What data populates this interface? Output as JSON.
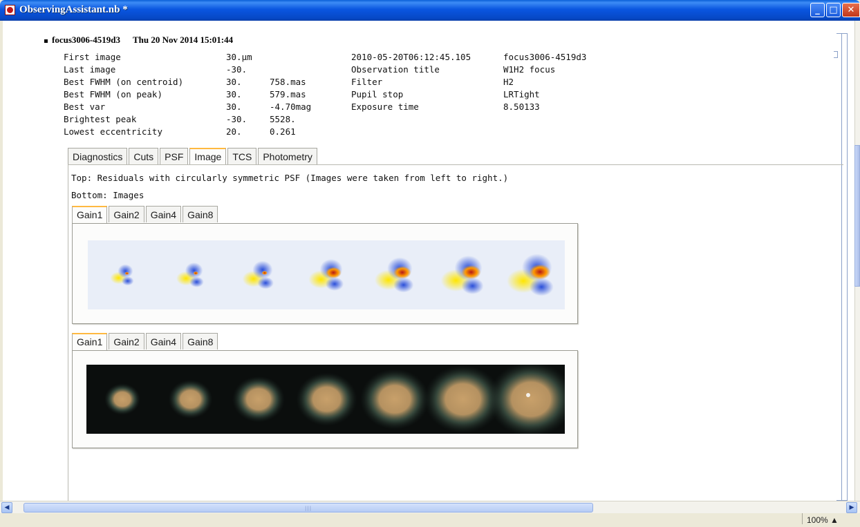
{
  "window": {
    "title": "ObservingAssistant.nb *",
    "buttons": {
      "minimize": "‗",
      "maximize": "□",
      "close": "✕"
    }
  },
  "cell": {
    "name": "focus3006-4519d3",
    "timestamp": "Thu 20 Nov 2014 15:01:44"
  },
  "summary": {
    "rows": [
      {
        "label": "First image",
        "value": "30.µm",
        "extra": ""
      },
      {
        "label": "Last image",
        "value": "-30.",
        "extra": ""
      },
      {
        "label": "Best FWHM (on centroid)",
        "value": "30.",
        "extra": "758.mas"
      },
      {
        "label": "Best FWHM (on peak)",
        "value": "30.",
        "extra": "579.mas"
      },
      {
        "label": "Best var",
        "value": "30.",
        "extra": "-4.70mag"
      },
      {
        "label": "Brightest peak",
        "value": "-30.",
        "extra": "5528."
      },
      {
        "label": "Lowest eccentricity",
        "value": "20.",
        "extra": "0.261"
      }
    ],
    "meta": [
      {
        "key": "2010-05-20T06:12:45.105",
        "value": "focus3006-4519d3"
      },
      {
        "key": "Observation title",
        "value": "W1H2 focus"
      },
      {
        "key": "Filter",
        "value": "H2"
      },
      {
        "key": "Pupil stop",
        "value": "LRTight"
      },
      {
        "key": "Exposure time",
        "value": "8.50133"
      }
    ]
  },
  "tabs": [
    "Diagnostics",
    "Cuts",
    "PSF",
    "Image",
    "TCS",
    "Photometry"
  ],
  "active_tab": "Image",
  "image_tab": {
    "caption_top": "Top: Residuals with circularly symmetric PSF (Images were taken from left to right.)",
    "caption_bottom": "Bottom: Images",
    "gain_tabs": [
      "Gain1",
      "Gain2",
      "Gain4",
      "Gain8"
    ],
    "active_gain_top": "Gain1",
    "active_gain_bottom": "Gain1",
    "residual_frames": 7,
    "image_frames": 7,
    "colors": {
      "residual_bg": "#e9eef8",
      "image_bg": "#0b0e0d",
      "core": "#c8a06a",
      "tab_accent": "#ffb940"
    }
  },
  "status": {
    "zoom": "100%"
  }
}
